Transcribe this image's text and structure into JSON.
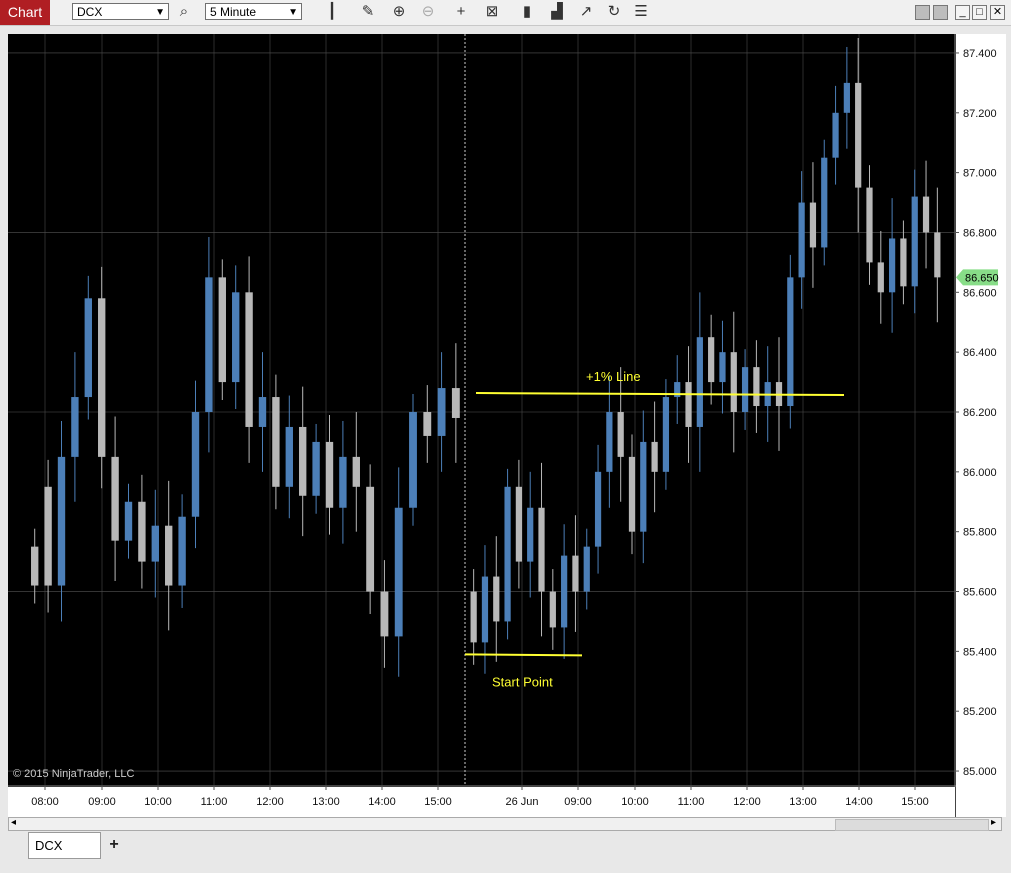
{
  "toolbar": {
    "chart_tab": "Chart",
    "instrument": "DCX",
    "interval": "5 Minute",
    "icons": [
      "search-icon",
      "bar-type-icon",
      "draw-pencil-icon",
      "zoom-in-icon",
      "zoom-out-icon",
      "crosshair-icon",
      "data-box-icon",
      "indicators-icon",
      "strategies-icon",
      "drawing-tools-icon",
      "reload-icon",
      "properties-icon"
    ],
    "window_icons": [
      "tile-icon",
      "tile-icon",
      "minimize-icon",
      "maximize-icon",
      "close-icon"
    ]
  },
  "chart": {
    "copyright": "© 2015 NinjaTrader, LLC",
    "last_price": "86.650",
    "colors": {
      "up": "#4c7fb8",
      "down": "#b8b8b8",
      "annotation": "#ffff32",
      "price_marker": "#88dd88"
    }
  },
  "chart_data": {
    "type": "candlestick",
    "ylim": [
      84.95,
      87.45
    ],
    "y_ticks": [
      "87.400",
      "87.200",
      "87.000",
      "86.800",
      "86.600",
      "86.400",
      "86.200",
      "86.000",
      "85.800",
      "85.600",
      "85.400",
      "85.200",
      "85.000"
    ],
    "x_ticks": [
      "08:00",
      "09:00",
      "10:00",
      "11:00",
      "12:00",
      "13:00",
      "14:00",
      "15:00",
      "26 Jun",
      "09:00",
      "10:00",
      "11:00",
      "12:00",
      "13:00",
      "14:00",
      "15:00"
    ],
    "session_break_after_tick": "15:00",
    "annotations": [
      {
        "label": "+1% Line",
        "y": 86.26
      },
      {
        "label": "Start Point",
        "y": 85.39
      }
    ],
    "segments": [
      {
        "points": [
          [
            85.75,
            85.62
          ],
          [
            85.95,
            85.62
          ],
          [
            85.62,
            86.05
          ],
          [
            86.05,
            86.25
          ],
          [
            86.25,
            86.58
          ],
          [
            86.58,
            86.05
          ],
          [
            86.05,
            85.77
          ],
          [
            85.77,
            85.9
          ],
          [
            85.9,
            85.7
          ],
          [
            85.7,
            85.82
          ],
          [
            85.82,
            85.62
          ],
          [
            85.62,
            85.85
          ],
          [
            85.85,
            86.2
          ],
          [
            86.2,
            86.65
          ],
          [
            86.65,
            86.3
          ],
          [
            86.3,
            86.6
          ],
          [
            86.6,
            86.15
          ],
          [
            86.15,
            86.25
          ],
          [
            86.25,
            85.95
          ],
          [
            85.95,
            86.15
          ],
          [
            86.15,
            85.92
          ],
          [
            85.92,
            86.1
          ],
          [
            86.1,
            85.88
          ],
          [
            85.88,
            86.05
          ],
          [
            86.05,
            85.95
          ]
        ],
        "x0": 20,
        "x1": 355
      },
      {
        "points": [
          [
            85.95,
            85.6
          ],
          [
            85.6,
            85.45
          ],
          [
            85.45,
            85.88
          ],
          [
            85.88,
            86.2
          ],
          [
            86.2,
            86.12
          ],
          [
            86.12,
            86.28
          ],
          [
            86.28,
            86.18
          ]
        ],
        "x0": 355,
        "x1": 455
      },
      {
        "points": [
          [
            85.6,
            85.43
          ],
          [
            85.43,
            85.65
          ],
          [
            85.65,
            85.5
          ],
          [
            85.5,
            85.95
          ],
          [
            85.95,
            85.7
          ],
          [
            85.7,
            85.88
          ],
          [
            85.88,
            85.6
          ],
          [
            85.6,
            85.48
          ],
          [
            85.48,
            85.72
          ],
          [
            85.72,
            85.6
          ],
          [
            85.6,
            85.75
          ],
          [
            85.75,
            86.0
          ],
          [
            86.0,
            86.2
          ],
          [
            86.2,
            86.05
          ],
          [
            86.05,
            85.8
          ],
          [
            85.8,
            86.1
          ],
          [
            86.1,
            86.0
          ],
          [
            86.0,
            86.25
          ],
          [
            86.25,
            86.3
          ],
          [
            86.3,
            86.15
          ],
          [
            86.15,
            86.45
          ],
          [
            86.45,
            86.3
          ],
          [
            86.3,
            86.4
          ],
          [
            86.4,
            86.2
          ],
          [
            86.2,
            86.35
          ],
          [
            86.35,
            86.22
          ],
          [
            86.22,
            86.3
          ],
          [
            86.3,
            86.22
          ],
          [
            86.22,
            86.65
          ],
          [
            86.65,
            86.9
          ],
          [
            86.9,
            86.75
          ],
          [
            86.75,
            87.05
          ],
          [
            87.05,
            87.2
          ],
          [
            87.2,
            87.3
          ],
          [
            87.3,
            86.95
          ],
          [
            86.95,
            86.7
          ],
          [
            86.7,
            86.6
          ],
          [
            86.6,
            86.78
          ],
          [
            86.78,
            86.62
          ],
          [
            86.62,
            86.92
          ],
          [
            86.92,
            86.8
          ],
          [
            86.8,
            86.65
          ]
        ],
        "x0": 460,
        "x1": 935
      }
    ]
  }
}
